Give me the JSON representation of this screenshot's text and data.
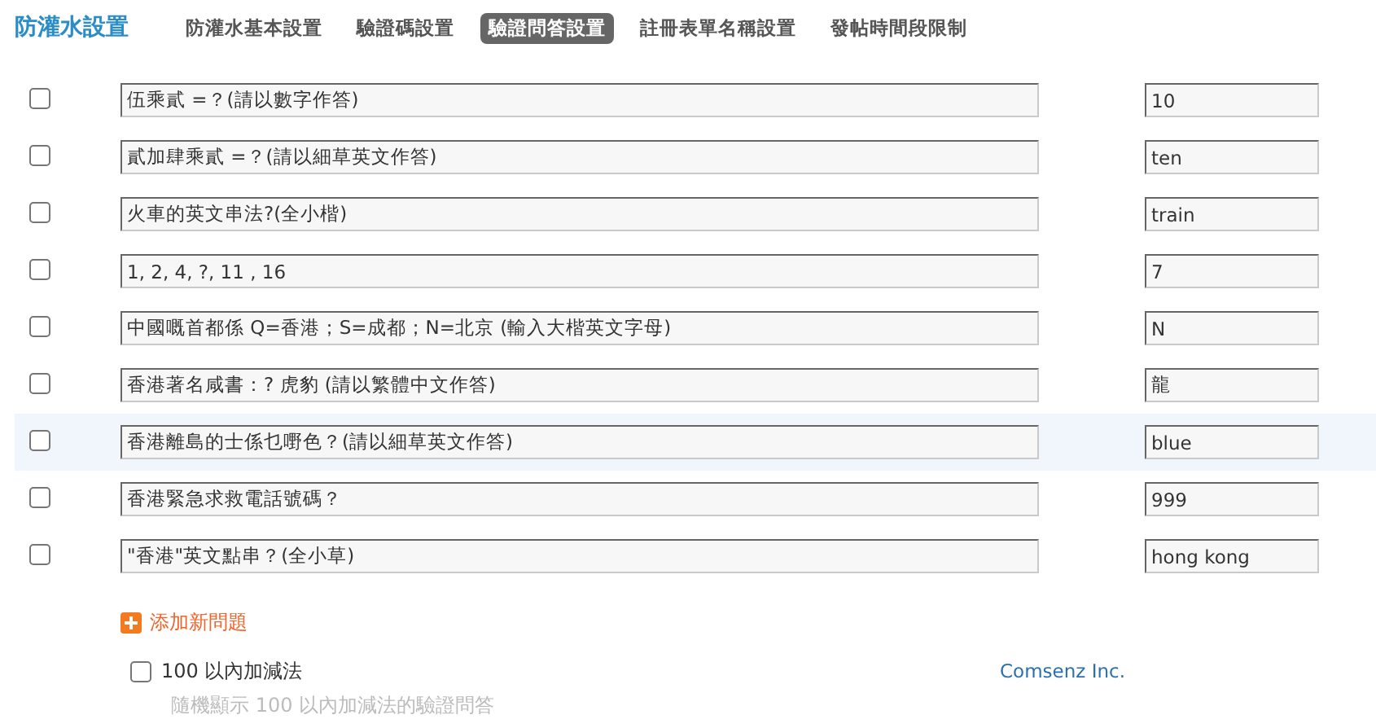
{
  "header": {
    "title": "防灌水設置",
    "tabs": [
      {
        "label": "防灌水基本設置",
        "selected": false
      },
      {
        "label": "驗證碼設置",
        "selected": false
      },
      {
        "label": "驗證問答設置",
        "selected": true
      },
      {
        "label": "註冊表單名稱設置",
        "selected": false
      },
      {
        "label": "發帖時間段限制",
        "selected": false
      }
    ]
  },
  "questions": [
    {
      "checked": false,
      "highlighted": false,
      "question": "伍乘貳 =？(請以數字作答)",
      "answer": "10"
    },
    {
      "checked": false,
      "highlighted": false,
      "question": "貳加肆乘貳 =？(請以細草英文作答)",
      "answer": "ten"
    },
    {
      "checked": false,
      "highlighted": false,
      "question": "火車的英文串法?(全小楷)",
      "answer": "train"
    },
    {
      "checked": false,
      "highlighted": false,
      "question": "1, 2, 4, ?, 11 , 16",
      "answer": "7"
    },
    {
      "checked": false,
      "highlighted": false,
      "question": "中國嘅首都係 Q=香港；S=成都；N=北京 (輸入大楷英文字母)",
      "answer": "N"
    },
    {
      "checked": false,
      "highlighted": false,
      "question": "香港著名咸書：? 虎豹 (請以繁體中文作答)",
      "answer": "龍"
    },
    {
      "checked": false,
      "highlighted": true,
      "question": "香港離島的士係乜嘢色？(請以細草英文作答)",
      "answer": "blue"
    },
    {
      "checked": false,
      "highlighted": false,
      "question": "香港緊急求救電話號碼？",
      "answer": "999"
    },
    {
      "checked": false,
      "highlighted": false,
      "question": "\"香港\"英文點串？(全小草)",
      "answer": "hong kong"
    }
  ],
  "add_link": "添加新問題",
  "option": {
    "checked": false,
    "label": "100 以內加減法",
    "description": "隨機顯示 100 以內加減法的驗證問答"
  },
  "footer": "Comsenz Inc."
}
